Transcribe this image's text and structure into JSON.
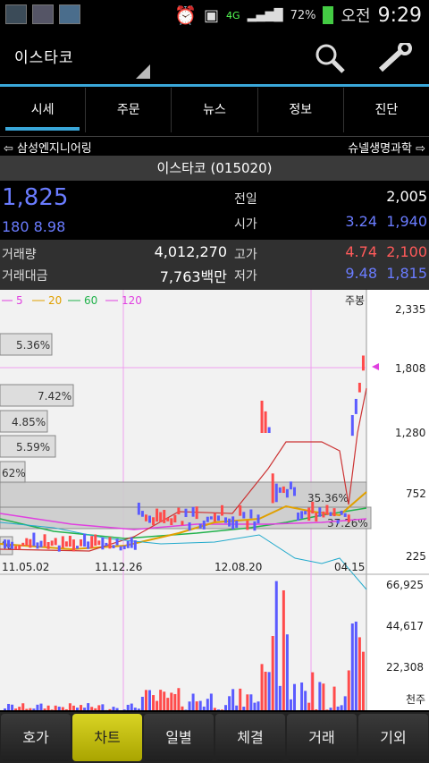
{
  "status": {
    "battery": "72%",
    "ampm": "오전",
    "time": "9:29",
    "net": "4G"
  },
  "app": {
    "title": "이스타코"
  },
  "tabs": [
    "시세",
    "주문",
    "뉴스",
    "정보",
    "진단"
  ],
  "nav": {
    "prev": "⇦ 삼성엔지니어링",
    "next": "슈넬생명과학 ⇨"
  },
  "stock": {
    "title": "이스타코 (015020)",
    "price": "1,825",
    "change": "180 8.98"
  },
  "quote": {
    "prev_label": "전일",
    "prev_value": "2,005",
    "open_label": "시가",
    "open_pct": "3.24",
    "open_value": "1,940"
  },
  "stats": {
    "volume_label": "거래량",
    "volume": "4,012,270",
    "high_label": "고가",
    "high_pct": "4.74",
    "high_value": "2,100",
    "amount_label": "거래대금",
    "amount": "7,763백만",
    "low_label": "저가",
    "low_pct": "9.48",
    "low_value": "1,815"
  },
  "chart": {
    "legend": [
      "5",
      "20",
      "60",
      "120"
    ],
    "period": "주봉",
    "price_axis": [
      "2,335",
      "1,808",
      "1,280",
      "752",
      "225"
    ],
    "volume_axis": [
      "66,925",
      "44,617",
      "22,308",
      "천주"
    ],
    "dates": [
      "11.05.02",
      "11.12.26",
      "12.08.20",
      "04.15"
    ],
    "profile_labels": [
      "5.36%",
      "7.42%",
      "4.85%",
      "5.59%",
      "62%",
      "%"
    ],
    "annotations": [
      "35.36%",
      "37.26%"
    ]
  },
  "colors": {
    "accent": "#3aa7d9",
    "up": "#ff4b4b",
    "down": "#5b5bff",
    "ma5": "#ff6ad5",
    "ma20": "#e0a000",
    "ma60": "#22b24c",
    "ma120": "#ff6ad5"
  },
  "chart_data": {
    "type": "candlestick",
    "ylim": [
      225,
      2335
    ],
    "x": [
      "11.05.02",
      "11.12.26",
      "12.08.20",
      "04.15"
    ],
    "close_series": [
      {
        "name": "price",
        "values": [
          330,
          300,
          420,
          560,
          690,
          640,
          600,
          1150,
          760,
          640,
          600,
          700,
          1825
        ]
      }
    ],
    "volume_ylim": [
      0,
      66925
    ]
  },
  "bottom_tabs": [
    "호가",
    "차트",
    "일별",
    "체결",
    "거래",
    "기외"
  ]
}
